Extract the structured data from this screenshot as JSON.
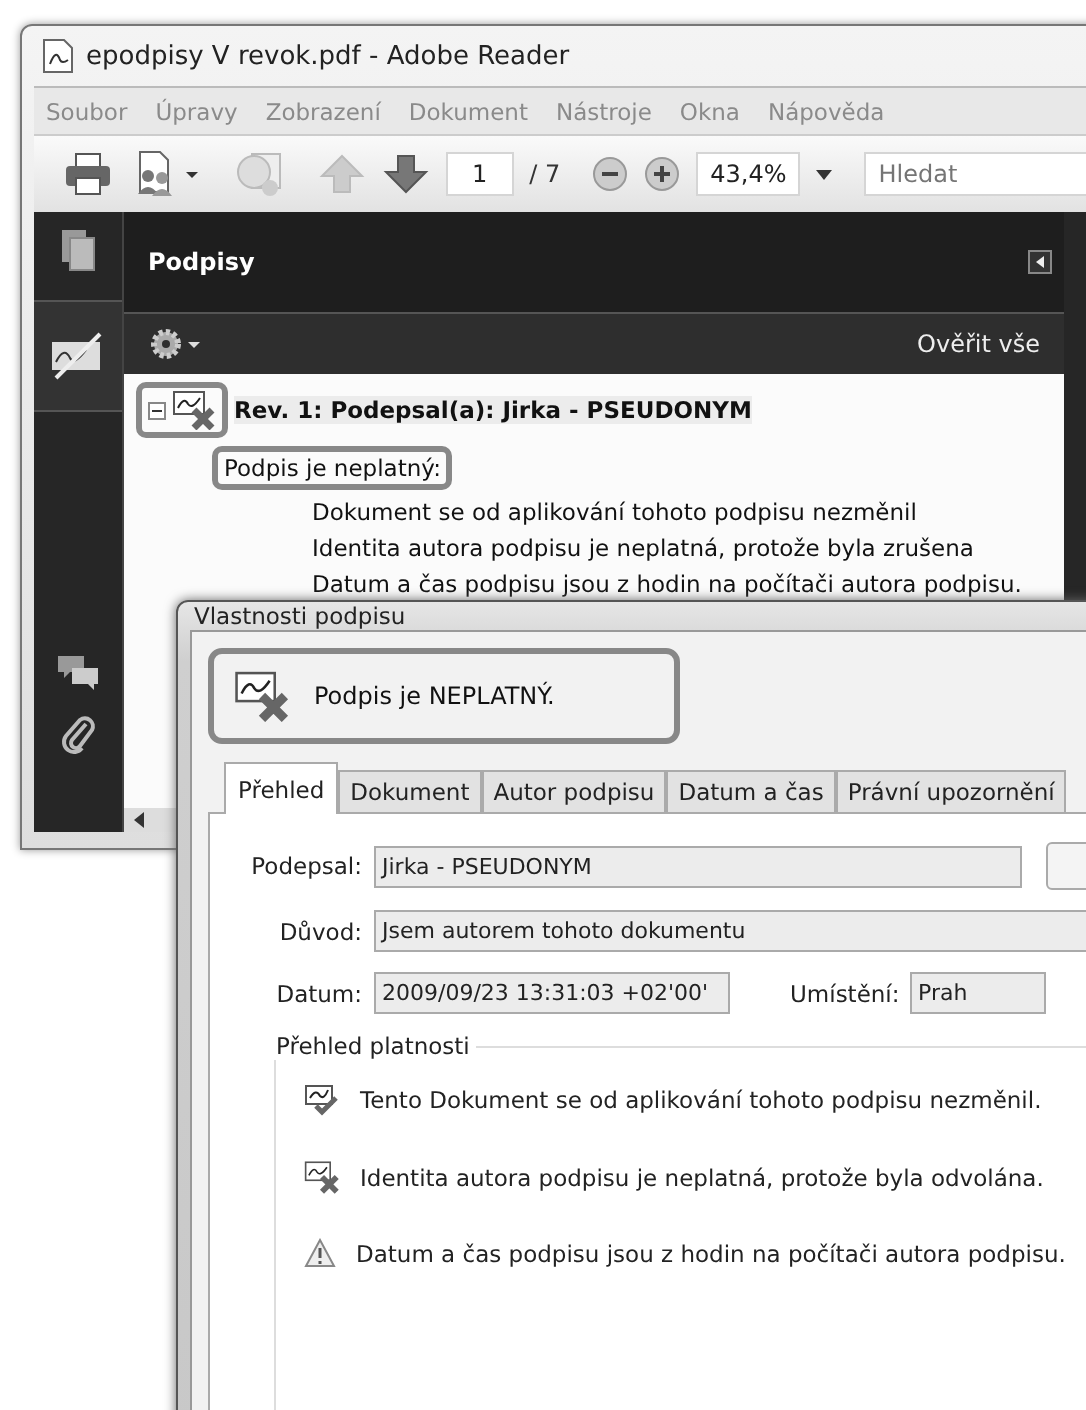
{
  "window": {
    "title": "epodpisy V revok.pdf - Adobe Reader"
  },
  "menu": [
    "Soubor",
    "Úpravy",
    "Zobrazení",
    "Dokument",
    "Nástroje",
    "Okna",
    "Nápověda"
  ],
  "toolbar": {
    "page": "1",
    "page_count": "/ 7",
    "zoom": "43,4%",
    "search": {
      "placeholder": "Hledat"
    }
  },
  "side_panel": {
    "title": "Podpisy",
    "action": "Ověřit vše",
    "tree": [
      {
        "label": "Rev. 1: Podepsal(a): Jirka - PSEUDONYM",
        "expanded": true,
        "highlighted": true,
        "children": [
          {
            "label": "Podpis je neplatný:",
            "highlighted": true,
            "children": [
              {
                "label": "Dokument se od aplikování tohoto podpisu nezměnil"
              },
              {
                "label": "Identita autora podpisu je neplatná, protože byla zrušena"
              },
              {
                "label": "Datum a čas podpisu jsou z hodin na počítači autora podpisu."
              }
            ]
          }
        ]
      }
    ]
  },
  "dialog": {
    "title": "Vlastnosti podpisu",
    "status": {
      "text": "Podpis je NEPLATNÝ.",
      "highlighted": true
    },
    "tabs": [
      {
        "label": "Přehled",
        "selected": true
      },
      {
        "label": "Dokument",
        "selected": false
      },
      {
        "label": "Autor podpisu",
        "selected": false
      },
      {
        "label": "Datum a čas",
        "selected": false
      },
      {
        "label": "Právní upozornění",
        "selected": false
      }
    ],
    "fields": {
      "signed_by": {
        "label": "Podepsal:",
        "value": "Jirka - PSEUDONYM"
      },
      "reason": {
        "label": "Důvod:",
        "value": "Jsem autorem tohoto dokumentu"
      },
      "date": {
        "label": "Datum:",
        "value": "2009/09/23 13:31:03 +02'00'"
      },
      "location": {
        "label": "Umístění:",
        "value": "Prah"
      }
    },
    "validity": {
      "title": "Přehled platnosti",
      "items": [
        {
          "kind": "unchanged",
          "text": "Tento Dokument se od aplikování tohoto podpisu nezměnil."
        },
        {
          "kind": "invalid",
          "text": "Identita autora podpisu je neplatná, protože byla odvolána."
        },
        {
          "kind": "warning",
          "text": "Datum a čas podpisu jsou z hodin na počítači autora podpisu."
        }
      ]
    }
  }
}
